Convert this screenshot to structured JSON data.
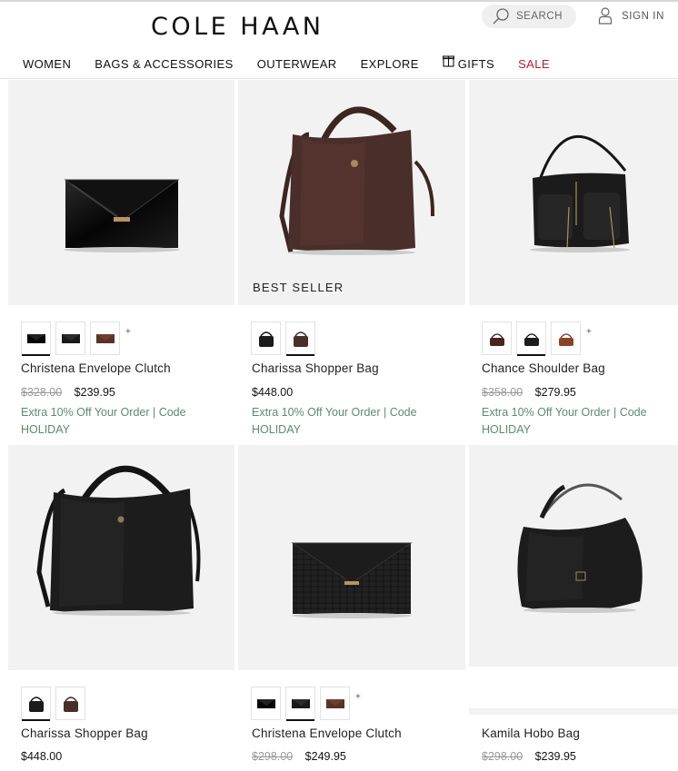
{
  "header": {
    "logo": "COLE HAAN",
    "search_label": "SEARCH",
    "signin_label": "SIGN IN"
  },
  "nav": {
    "items": [
      {
        "label": "WOMEN"
      },
      {
        "label": "BAGS & ACCESSORIES"
      },
      {
        "label": "OUTERWEAR"
      },
      {
        "label": "EXPLORE"
      },
      {
        "label": "GIFTS"
      },
      {
        "label": "SALE"
      }
    ]
  },
  "colors": {
    "sale": "#b3202b",
    "promo": "#5b8a6f",
    "image_bg": "#f2f2f2"
  },
  "products": [
    {
      "name": "Christena Envelope Clutch",
      "badge": "",
      "old_price": "$328.00",
      "price": "$239.95",
      "promo": "Extra 10% Off Your Order | Code HOLIDAY",
      "swatch_more": "+",
      "swatches": [
        "black patent",
        "black",
        "brown"
      ]
    },
    {
      "name": "Charissa Shopper Bag",
      "badge": "BEST SELLER",
      "old_price": "",
      "price": "$448.00",
      "promo": "Extra 10% Off Your Order | Code HOLIDAY",
      "swatch_more": "",
      "swatches": [
        "black",
        "brown"
      ]
    },
    {
      "name": "Chance Shoulder Bag",
      "badge": "",
      "old_price": "$358.00",
      "price": "$279.95",
      "promo": "Extra 10% Off Your Order | Code HOLIDAY",
      "swatch_more": "+",
      "swatches": [
        "dark brown",
        "black",
        "cognac"
      ]
    },
    {
      "name": "Charissa Shopper Bag",
      "badge": "",
      "old_price": "",
      "price": "$448.00",
      "promo": "",
      "swatch_more": "",
      "swatches": [
        "black",
        "brown"
      ]
    },
    {
      "name": "Christena Envelope Clutch",
      "badge": "",
      "old_price": "$298.00",
      "price": "$249.95",
      "promo": "",
      "swatch_more": "+",
      "swatches": [
        "black",
        "black croc",
        "brown"
      ]
    },
    {
      "name": "Kamila Hobo Bag",
      "badge": "",
      "old_price": "$298.00",
      "price": "$239.95",
      "promo": "",
      "swatch_more": "",
      "swatches": []
    }
  ]
}
